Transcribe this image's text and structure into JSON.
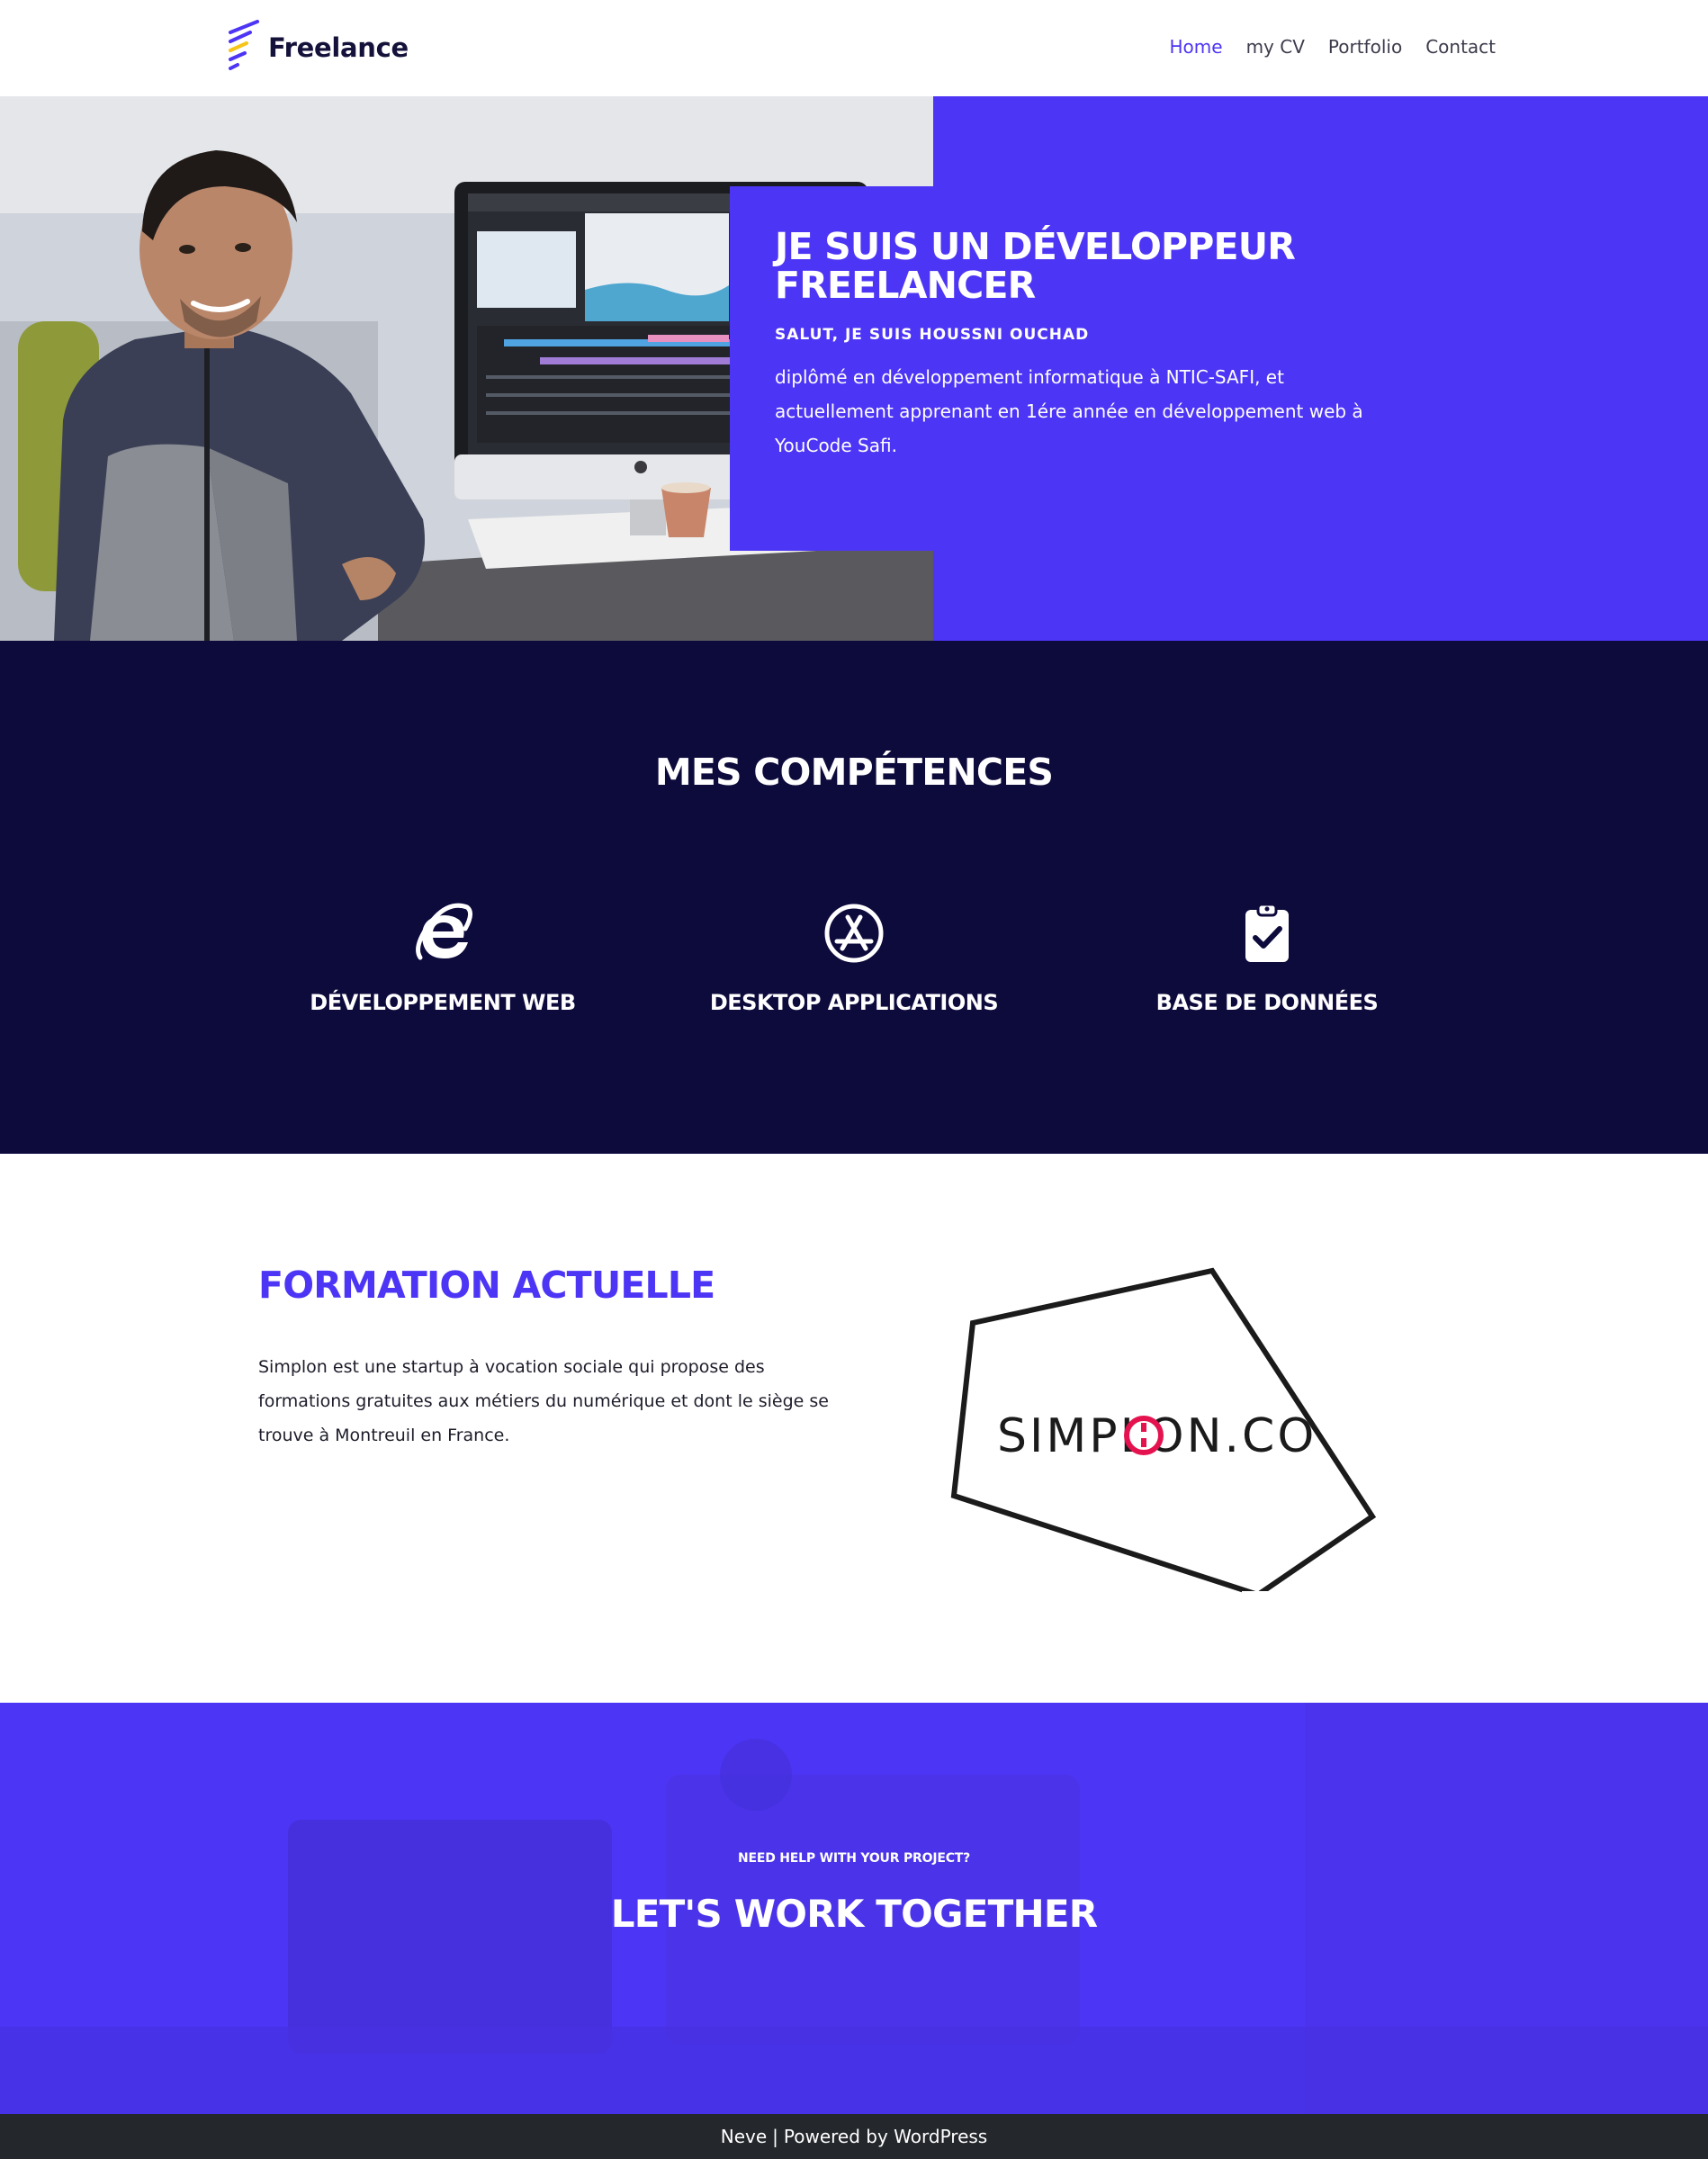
{
  "header": {
    "logo_text": "Freelance",
    "nav": [
      {
        "label": "Home",
        "active": true
      },
      {
        "label": "my CV",
        "active": false
      },
      {
        "label": "Portfolio",
        "active": false
      },
      {
        "label": "Contact",
        "active": false
      }
    ]
  },
  "hero": {
    "title": "Je suis un Développeur freelancer",
    "subtitle": "Salut, je suis Houssni Ouchad",
    "text": "diplômé en développement informatique à NTIC-SAFI, et actuellement apprenant en 1ére année en développement web à YouCode Safi."
  },
  "skills": {
    "title": "Mes compétences",
    "items": [
      {
        "label": "Développement Web",
        "icon": "internet-explorer-icon"
      },
      {
        "label": "Desktop applications",
        "icon": "app-store-icon"
      },
      {
        "label": "Base de données",
        "icon": "clipboard-check-icon"
      }
    ]
  },
  "formation": {
    "title": "Formation actuelle",
    "text": "Simplon est une startup à vocation sociale qui propose des formations gratuites aux métiers du numérique et dont le siège se trouve à Montreuil en France.",
    "logo_text": "SIMPLON.CO"
  },
  "cta": {
    "kicker": "Need help with your project?",
    "title": "Let's work together"
  },
  "footer": {
    "theme": "Neve",
    "separator": "|",
    "powered": "Powered by WordPress"
  },
  "colors": {
    "accent": "#4d35f5",
    "dark": "#0d0a3c",
    "footer": "#24272b",
    "logo_red": "#e4134f"
  }
}
